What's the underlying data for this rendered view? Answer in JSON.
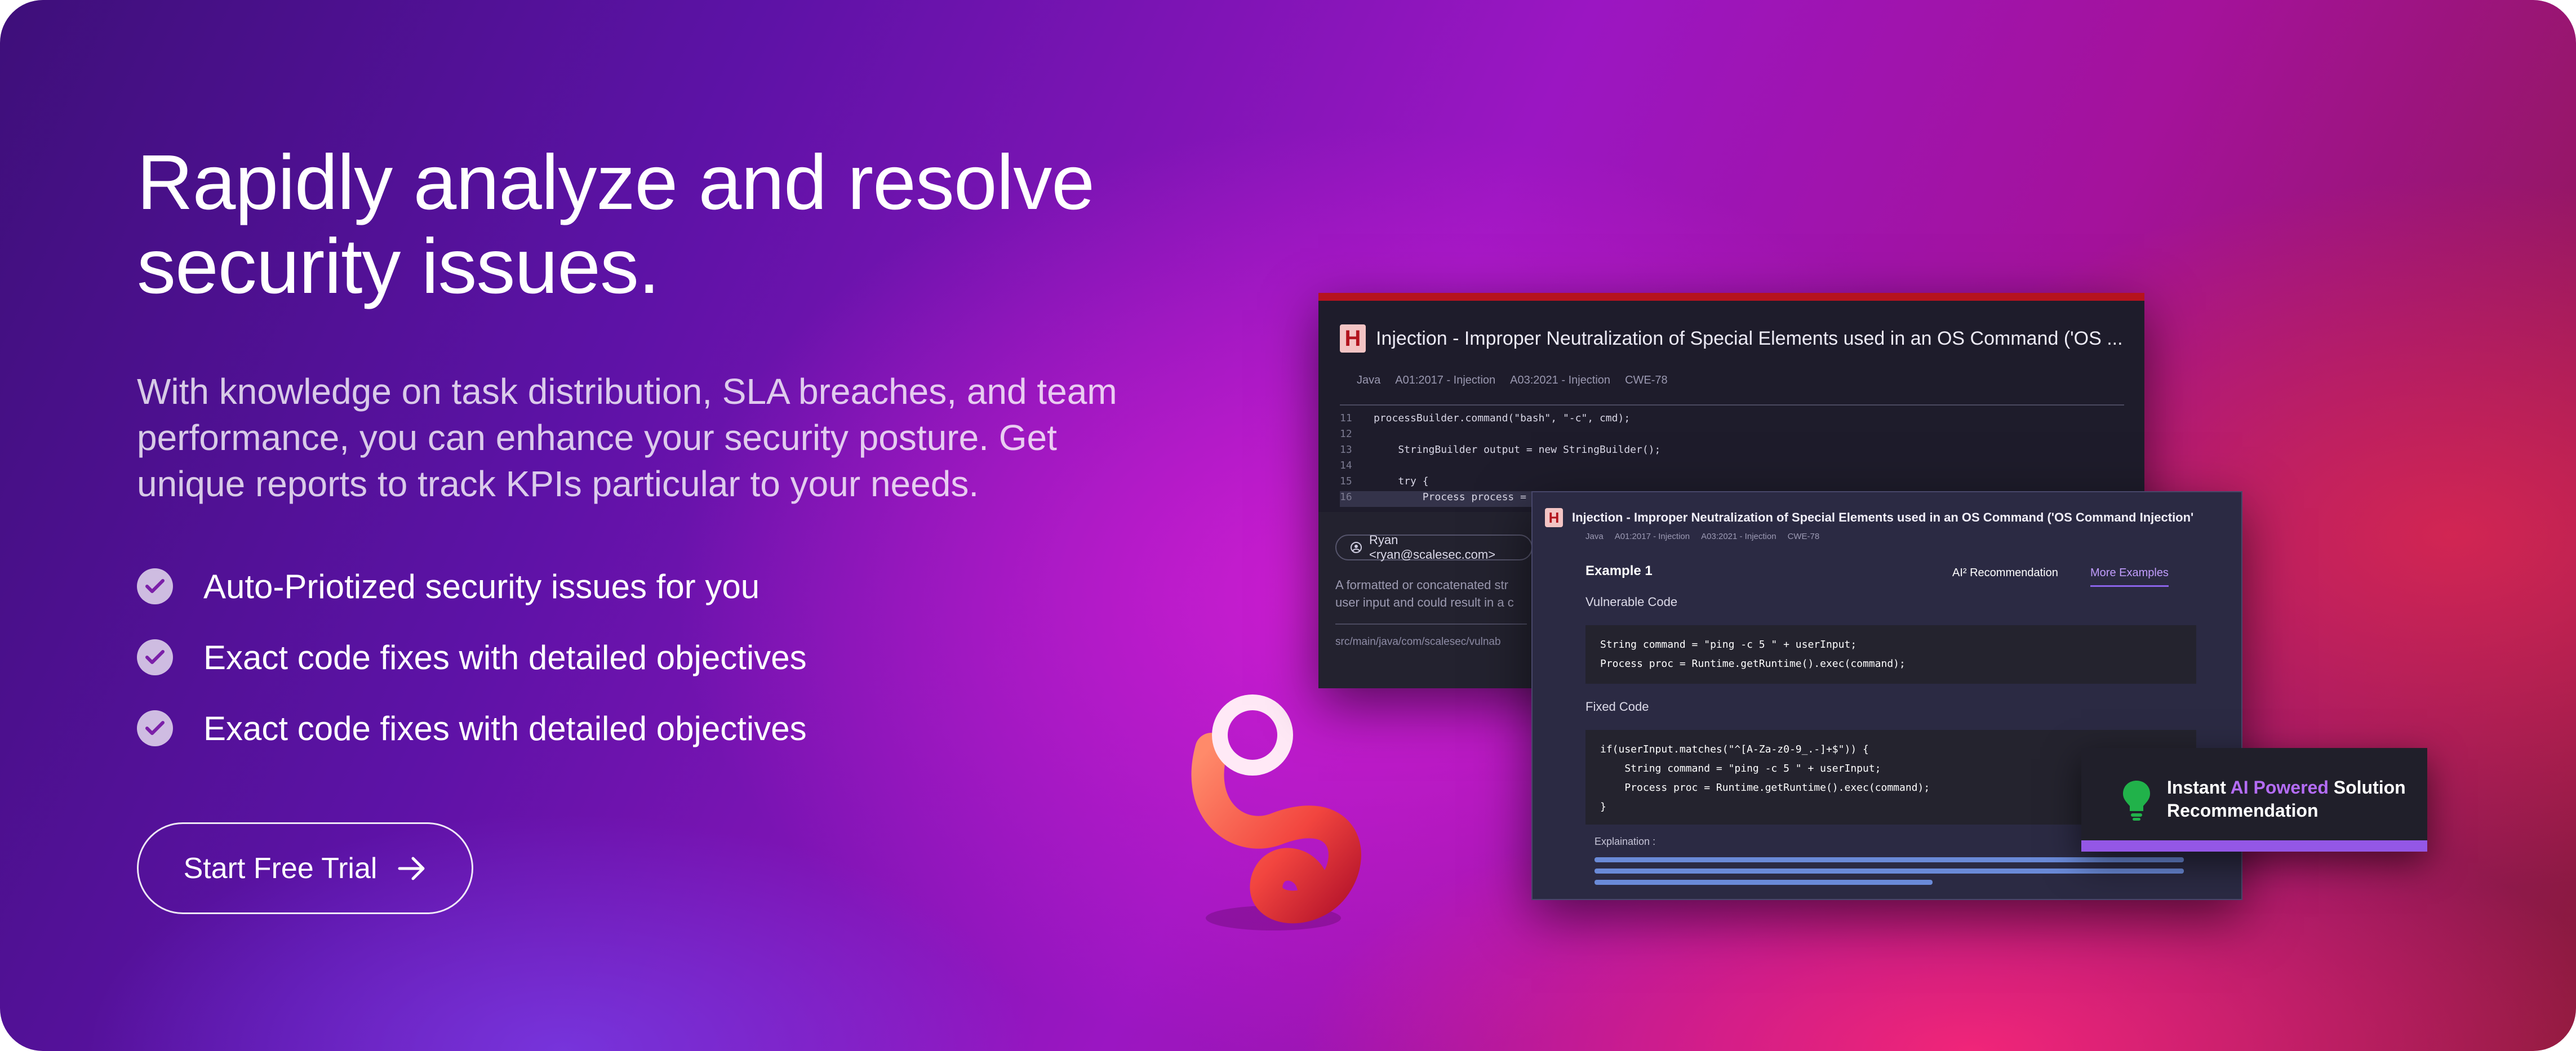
{
  "hero": {
    "title": "Rapidly analyze and resolve security issues.",
    "description": "With knowledge on task distribution, SLA breaches, and team performance, you can enhance your security posture. Get unique reports to track KPIs particular to your needs.",
    "features": [
      "Auto-Priotized security issues for you",
      "Exact code fixes with detailed objectives",
      "Exact code fixes with detailed objectives"
    ],
    "cta_label": "Start Free Trial"
  },
  "icons": {
    "feature": "check-circle-icon",
    "cta": "arrow-right-icon",
    "card": "lightbulb-icon"
  },
  "screenshot1": {
    "logo": "H",
    "title": "Injection - Improper Neutralization of Special Elements used in an OS Command ('OS ...",
    "meta": [
      "Java",
      "A01:2017 - Injection",
      "A03:2021 - Injection",
      "CWE-78"
    ],
    "code": [
      {
        "num": "11",
        "text": "processBuilder.command(\"bash\", \"-c\", cmd);"
      },
      {
        "num": "12",
        "text": ""
      },
      {
        "num": "13",
        "text": "    StringBuilder output = new StringBuilder();"
      },
      {
        "num": "14",
        "text": ""
      },
      {
        "num": "15",
        "text": "    try {"
      },
      {
        "num": "16",
        "text": "        Process process = processBuilder.start();"
      }
    ],
    "author": "Ryan <ryan@scalesec.com>",
    "comment_line1": "A formatted or concatenated str",
    "comment_line2": "user input and could result in a c",
    "path": "src/main/java/com/scalesec/vulnab"
  },
  "screenshot2": {
    "logo": "H",
    "title": "Injection - Improper Neutralization of Special Elements used in an OS Command ('OS Command Injection'",
    "meta": [
      "Java",
      "A01:2017 - Injection",
      "A03:2021 - Injection",
      "CWE-78"
    ],
    "example_title": "Example 1",
    "tab_ai": "AI² Recommendation",
    "tab_more": "More Examples",
    "vulnerable_label": "Vulnerable Code",
    "vulnerable_code": "String command = \"ping -c 5 \" + userInput;\nProcess proc = Runtime.getRuntime().exec(command);",
    "fixed_label": "Fixed Code",
    "fixed_code": "if(userInput.matches(\"^[A-Za-z0-9_.-]+$\")) {\n    String command = \"ping -c 5 \" + userInput;\n    Process proc = Runtime.getRuntime().exec(command);\n}",
    "explanation_label": "Explaination :"
  },
  "card": {
    "prefix": "Instant ",
    "highlight": "AI Powered",
    "suffix": " Solution",
    "line2": "Recommendation"
  },
  "colors": {
    "accent_purple": "#9457e6",
    "issue_red": "#b6131e",
    "bulb_green": "#21b24a",
    "swirl_orange": "#f2564a"
  }
}
